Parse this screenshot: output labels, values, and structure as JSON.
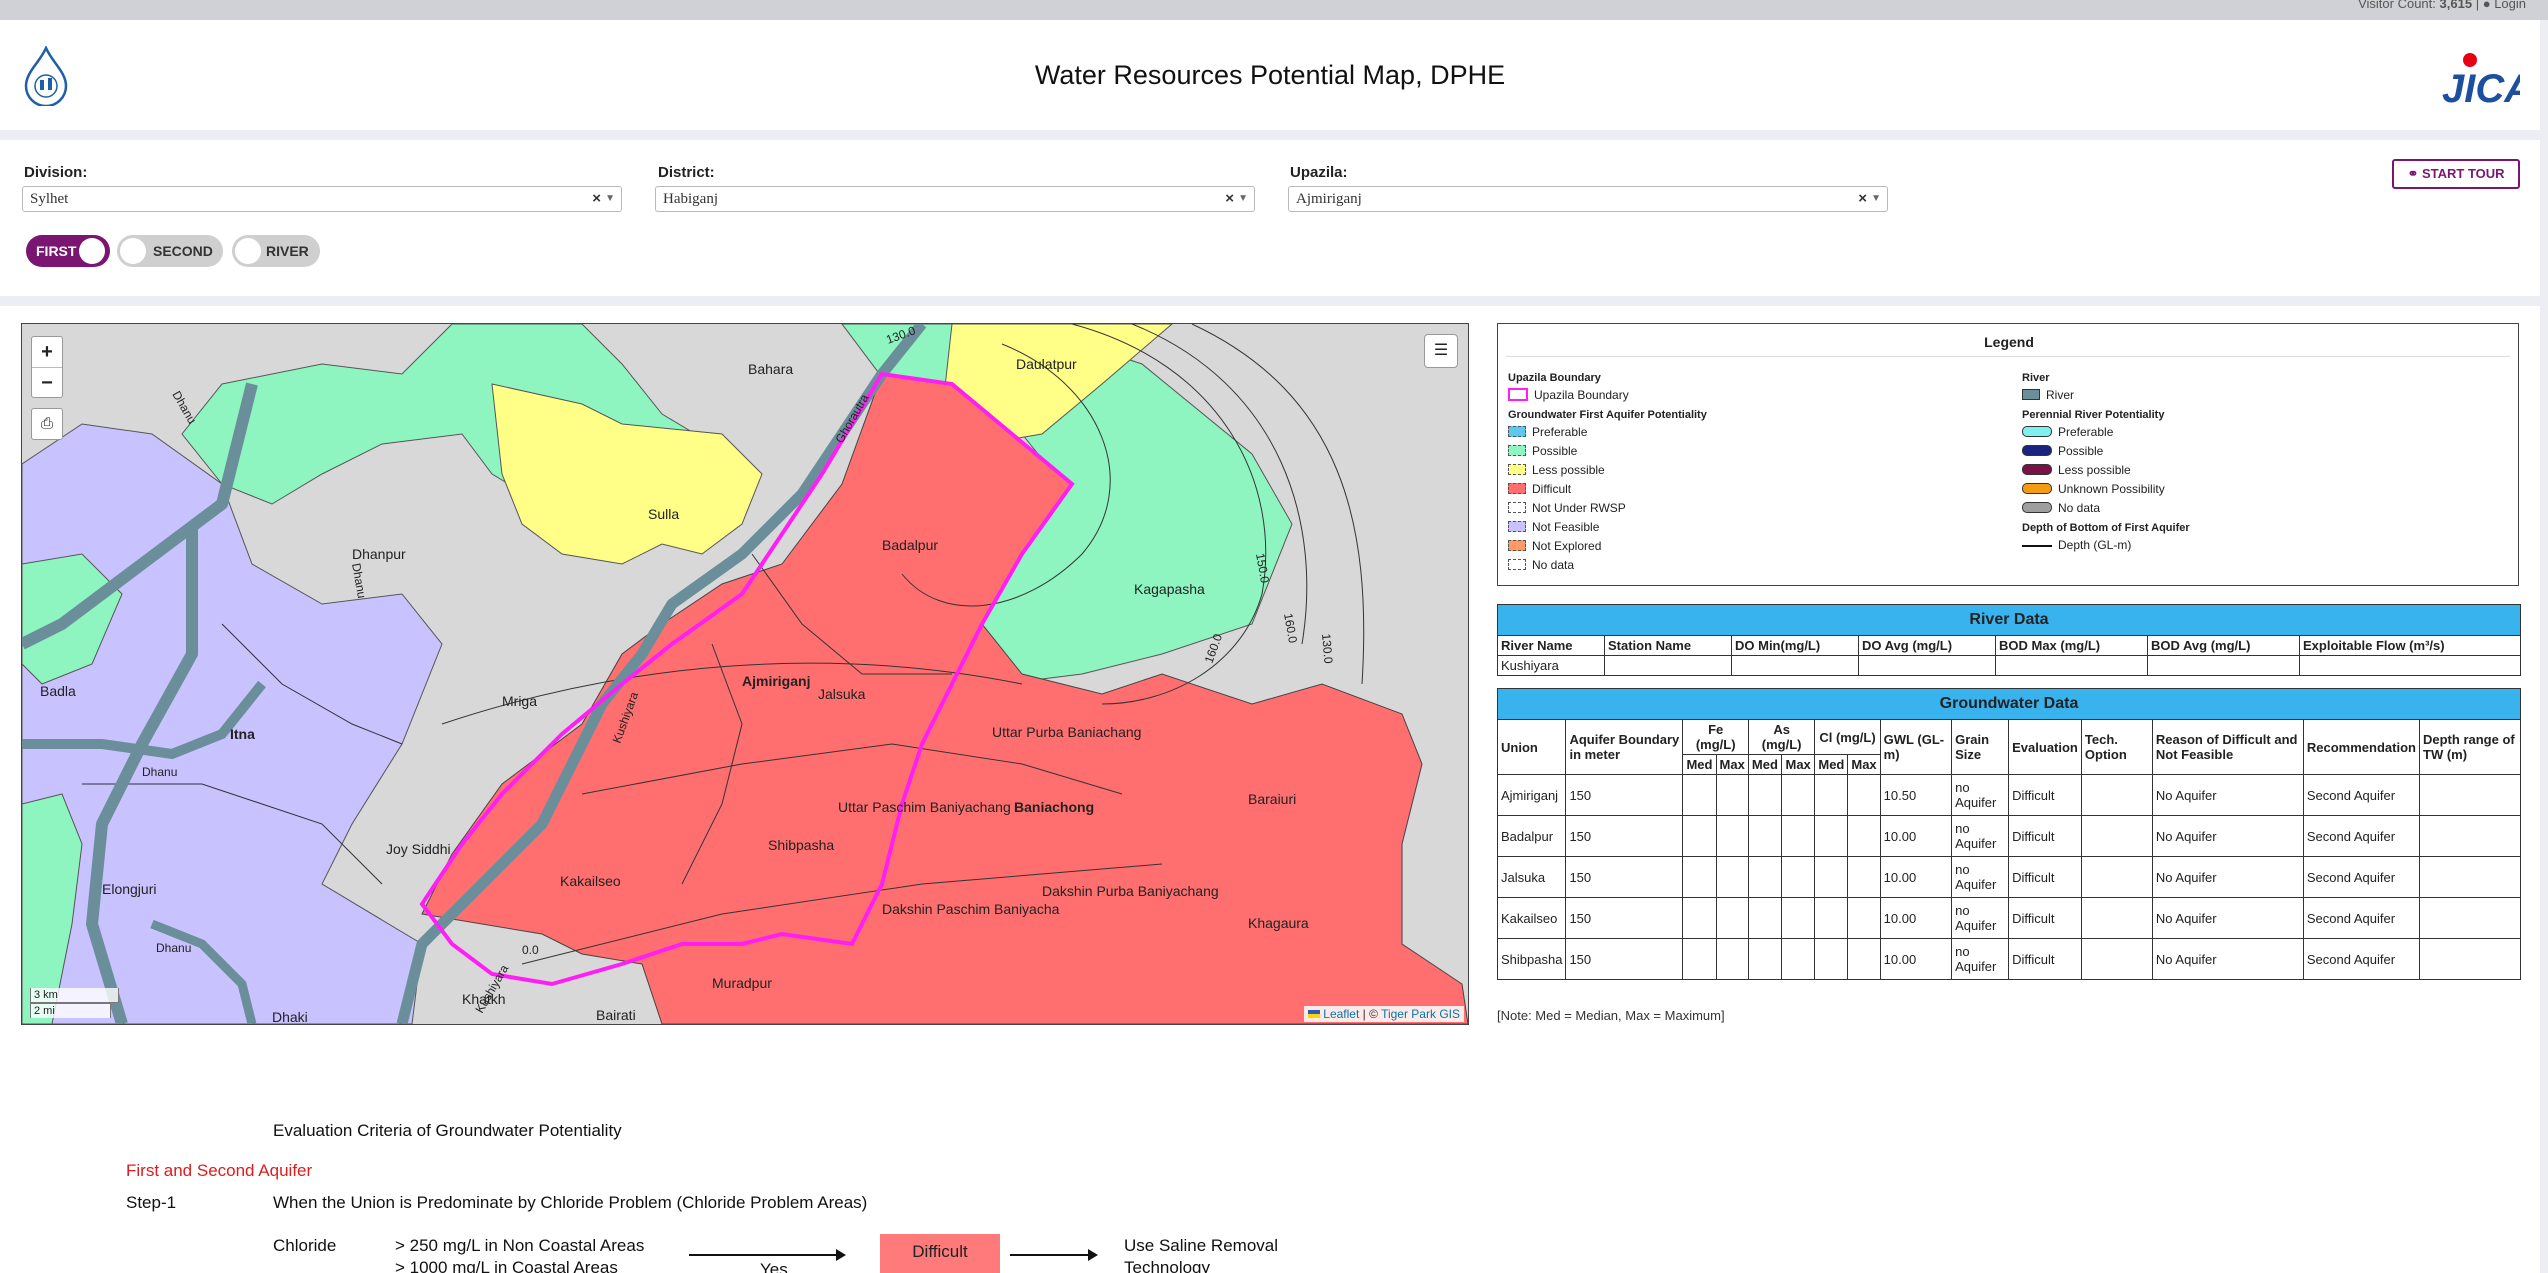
{
  "topbar": {
    "visitor_label": "Visitor Count:",
    "visitor_count": "3,615",
    "separator": "|",
    "login_label": "Login"
  },
  "header": {
    "title": "Water Resources Potential Map, DPHE",
    "right_logo_text": "JICA"
  },
  "filters": {
    "division_label": "Division:",
    "division_value": "Sylhet",
    "district_label": "District:",
    "district_value": "Habiganj",
    "upazila_label": "Upazila:",
    "upazila_value": "Ajmiriganj",
    "clear_symbol": "×",
    "start_tour_label": "START TOUR",
    "toggles": [
      {
        "label": "FIRST",
        "on": true
      },
      {
        "label": "SECOND",
        "on": false
      },
      {
        "label": "RIVER",
        "on": false
      }
    ]
  },
  "map": {
    "zoom_in": "+",
    "zoom_out": "−",
    "scale_km": "3 km",
    "scale_mi": "2 mi",
    "attribution_leaflet": "Leaflet",
    "attribution_sep": "| ©",
    "attribution_owner": "Tiger Park GIS",
    "place_names": [
      "Bahara",
      "Daulatpur",
      "Sulla",
      "Dhanpur",
      "Badalpur",
      "Kagapasha",
      "Badla",
      "Mriga",
      "Itna",
      "Ajmiriganj",
      "Jalsuka",
      "Uttar Purba Baniachang",
      "Uttar Paschim Baniyachang",
      "Baniachong",
      "Joy Siddhi",
      "Shibpasha",
      "Kakailseo",
      "Elongjuri",
      "Dakshin Purba Baniyachang",
      "Dakshin Paschim Baniyacha",
      "Baraiuri",
      "Khagaura",
      "Muradpur",
      "Bairati",
      "Dhaki",
      "Khatkh"
    ],
    "river_labels": [
      "Kushiyara",
      "Dhanu",
      "Dhanu",
      "Dhanu",
      "Dhanu",
      "Ghorautra",
      "Kushiyara"
    ],
    "contour_labels": [
      "150.0",
      "160.0",
      "130.0",
      "160.0",
      "130.0",
      "0.0"
    ]
  },
  "legend": {
    "title": "Legend",
    "upazila_section": "Upazila Boundary",
    "upazila_item": "Upazila Boundary",
    "gw_section": "Groundwater First Aquifer Potentiality",
    "gw_items": [
      {
        "label": "Preferable",
        "color": "#5bc8f0"
      },
      {
        "label": "Possible",
        "color": "#8ef5c0"
      },
      {
        "label": "Less possible",
        "color": "#ffff88"
      },
      {
        "label": "Difficult",
        "color": "#ff6f6f"
      },
      {
        "label": "Not Under RWSP",
        "color": "#ffffff"
      },
      {
        "label": "Not Feasible",
        "color": "#c8c2ff"
      },
      {
        "label": "Not Explored",
        "color": "#ff9a66"
      },
      {
        "label": "No data",
        "color": "#ffffff"
      }
    ],
    "river_section": "River",
    "river_item": "River",
    "perennial_section": "Perennial River Potentiality",
    "perennial_items": [
      {
        "label": "Preferable",
        "color": "#7ff0ee"
      },
      {
        "label": "Possible",
        "color": "#1a237e"
      },
      {
        "label": "Less possible",
        "color": "#7a1248"
      },
      {
        "label": "Unknown Possibility",
        "color": "#f39c12"
      },
      {
        "label": "No data",
        "color": "#9e9e9e"
      }
    ],
    "depth_section": "Depth of Bottom of First Aquifer",
    "depth_item": "Depth (GL-m)"
  },
  "river_data": {
    "title": "River Data",
    "headers": [
      "River Name",
      "Station Name",
      "DO Min(mg/L)",
      "DO Avg (mg/L)",
      "BOD Max (mg/L)",
      "BOD Avg (mg/L)",
      "Exploitable Flow (m³/s)"
    ],
    "rows": [
      [
        "Kushiyara",
        "",
        "",
        "",
        "",
        "",
        ""
      ]
    ]
  },
  "groundwater_data": {
    "title": "Groundwater Data",
    "h_union": "Union",
    "h_boundary": "Aquifer Boundary in meter",
    "h_fe": "Fe (mg/L)",
    "h_as": "As (mg/L)",
    "h_cl": "Cl (mg/L)",
    "h_gwl": "GWL (GL-m)",
    "h_grain": "Grain Size",
    "h_eval": "Evaluation",
    "h_tech": "Tech. Option",
    "h_reason": "Reason of Difficult and Not Feasible",
    "h_recom": "Recommendation",
    "h_depth": "Depth range of TW (m)",
    "h_med": "Med",
    "h_max": "Max",
    "rows": [
      {
        "union": "Ajmiriganj",
        "boundary": "150",
        "gwl": "10.50",
        "grain": "no Aquifer",
        "eval": "Difficult",
        "reason": "No Aquifer",
        "recom": "Second Aquifer"
      },
      {
        "union": "Badalpur",
        "boundary": "150",
        "gwl": "10.00",
        "grain": "no Aquifer",
        "eval": "Difficult",
        "reason": "No Aquifer",
        "recom": "Second Aquifer"
      },
      {
        "union": "Jalsuka",
        "boundary": "150",
        "gwl": "10.00",
        "grain": "no Aquifer",
        "eval": "Difficult",
        "reason": "No Aquifer",
        "recom": "Second Aquifer"
      },
      {
        "union": "Kakailseo",
        "boundary": "150",
        "gwl": "10.00",
        "grain": "no Aquifer",
        "eval": "Difficult",
        "reason": "No Aquifer",
        "recom": "Second Aquifer"
      },
      {
        "union": "Shibpasha",
        "boundary": "150",
        "gwl": "10.00",
        "grain": "no Aquifer",
        "eval": "Difficult",
        "reason": "No Aquifer",
        "recom": "Second Aquifer"
      }
    ],
    "note": "[Note: Med = Median, Max = Maximum]"
  },
  "evaluation": {
    "title": "Evaluation Criteria of Groundwater Potentiality",
    "subtitle": "First and Second Aquifer",
    "step": "Step-1",
    "step_text": "When the Union is Predominate by Chloride Problem (Chloride Problem Areas)",
    "param": "Chloride",
    "cond1": "> 250 mg/L in Non Coastal Areas",
    "cond2": "> 1000 mg/L in Coastal Areas",
    "yes": "Yes",
    "result": "Difficult",
    "action1": "Use Saline Removal",
    "action2": "Technology"
  }
}
